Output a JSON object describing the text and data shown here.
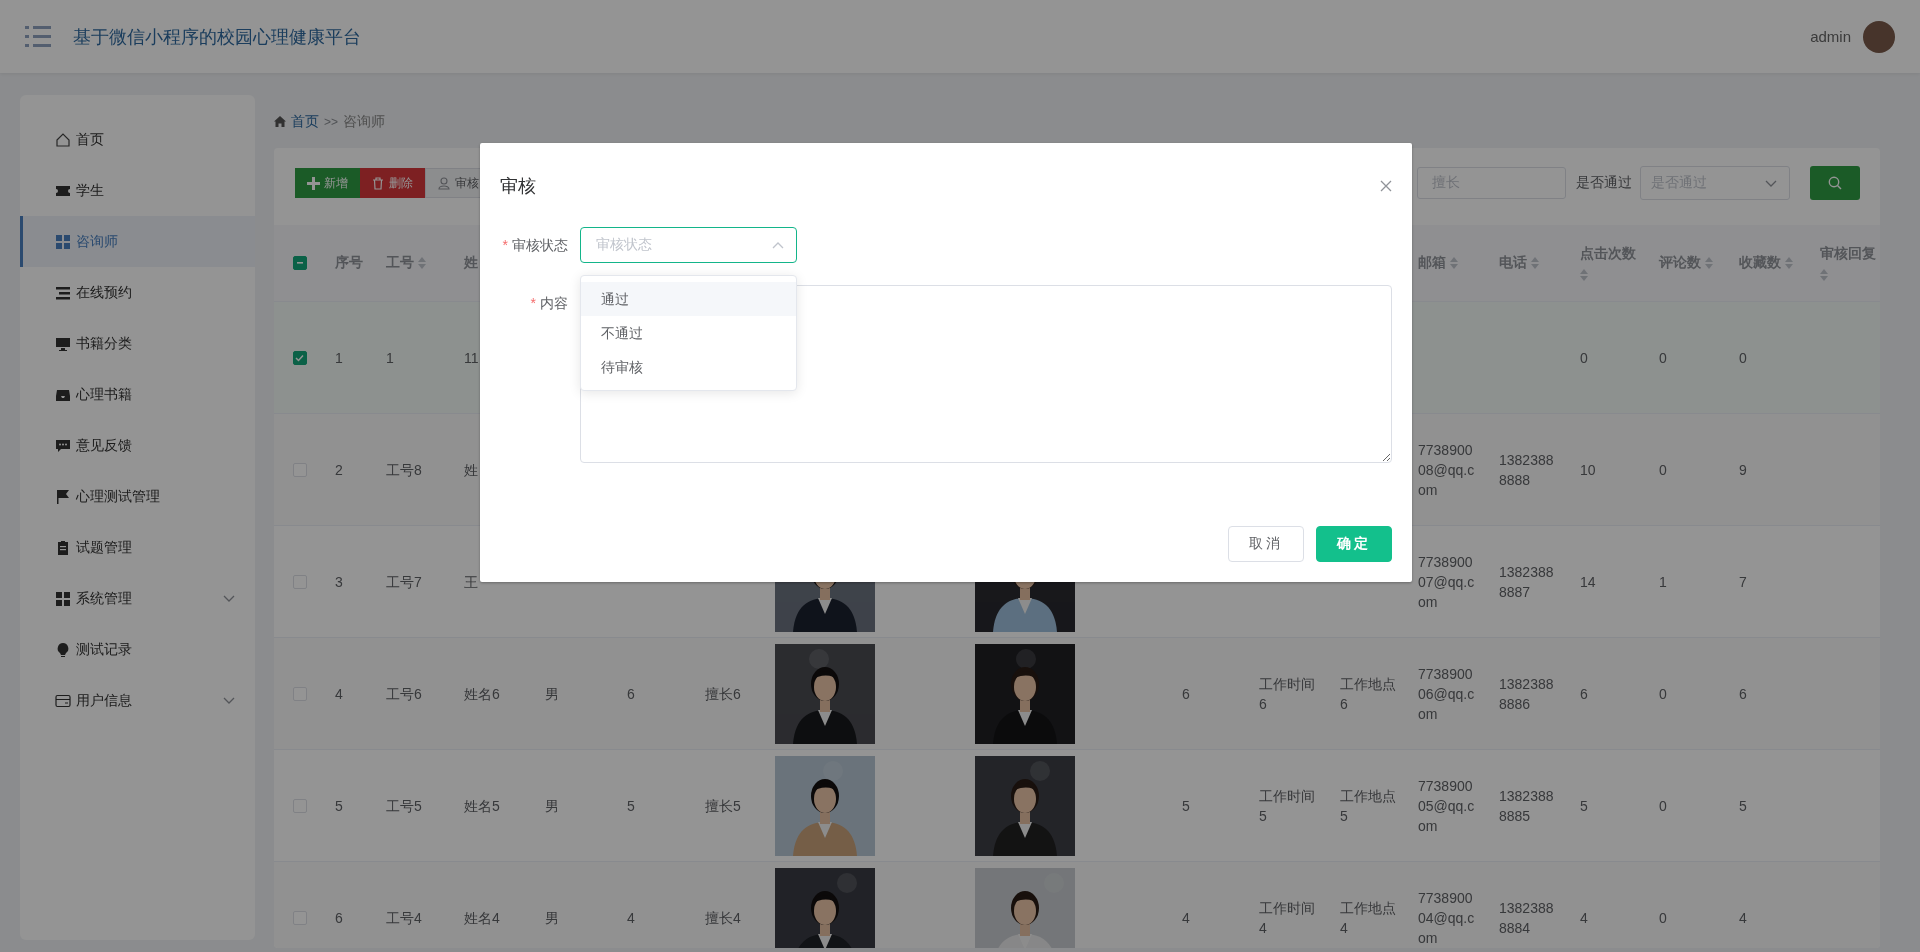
{
  "header": {
    "title": "基于微信小程序的校园心理健康平台",
    "user": "admin"
  },
  "sidebar": {
    "items": [
      {
        "label": "首页",
        "selected": false,
        "expandable": false
      },
      {
        "label": "学生",
        "selected": false,
        "expandable": false
      },
      {
        "label": "咨询师",
        "selected": true,
        "expandable": false
      },
      {
        "label": "在线预约",
        "selected": false,
        "expandable": false
      },
      {
        "label": "书籍分类",
        "selected": false,
        "expandable": false
      },
      {
        "label": "心理书籍",
        "selected": false,
        "expandable": false
      },
      {
        "label": "意见反馈",
        "selected": false,
        "expandable": false
      },
      {
        "label": "心理测试管理",
        "selected": false,
        "expandable": false
      },
      {
        "label": "试题管理",
        "selected": false,
        "expandable": false
      },
      {
        "label": "系统管理",
        "selected": false,
        "expandable": true
      },
      {
        "label": "测试记录",
        "selected": false,
        "expandable": false
      },
      {
        "label": "用户信息",
        "selected": false,
        "expandable": true
      }
    ]
  },
  "breadcrumb": {
    "items": [
      "首页",
      "咨询师"
    ],
    "separator": ">>"
  },
  "toolbar": {
    "buttons": [
      {
        "label": "新增",
        "kind": "add"
      },
      {
        "label": "删除",
        "kind": "delete"
      },
      {
        "label": "审核",
        "kind": "audit"
      }
    ],
    "filters": [
      {
        "kind": "input",
        "placeholder": "擅长"
      },
      {
        "kind": "select",
        "label": "是否通过",
        "placeholder": "是否通过"
      }
    ]
  },
  "table": {
    "select_all": {
      "indeterminate": true
    },
    "columns": [
      {
        "label": "序号",
        "sortable": false
      },
      {
        "label": "工号",
        "sortable": true
      },
      {
        "label": "姓",
        "sortable": false
      },
      null,
      null,
      null,
      null,
      null,
      null,
      null,
      null,
      {
        "label": "邮箱",
        "sortable": true
      },
      {
        "label": "电话",
        "sortable": true
      },
      {
        "label": "点击次数",
        "sortable": true
      },
      {
        "label": "评论数",
        "sortable": true
      },
      {
        "label": "收藏数",
        "sortable": true
      },
      {
        "label": "审核回复",
        "sortable": true
      }
    ],
    "rows": [
      {
        "selected": true,
        "cells": [
          "1",
          "1",
          "11",
          null,
          null,
          null,
          null,
          null,
          null,
          null,
          null,
          null,
          null,
          "0",
          "0",
          "0",
          null
        ]
      },
      {
        "selected": false,
        "cells": [
          "2",
          "工号8",
          "姓",
          null,
          null,
          null,
          null,
          null,
          null,
          null,
          null,
          "773890008@qq.com",
          "13823888888",
          "10",
          "0",
          "9",
          null
        ]
      },
      {
        "selected": false,
        "cells": [
          "3",
          "工号7",
          "王",
          null,
          null,
          null,
          {
            "kind": "picture"
          },
          {
            "kind": "picture"
          },
          null,
          null,
          null,
          "773890007@qq.com",
          "13823888887",
          "14",
          "1",
          "7",
          null
        ]
      },
      {
        "selected": false,
        "cells": [
          "4",
          "工号6",
          "姓名6",
          "男",
          "6",
          "擅长6",
          {
            "kind": "picture"
          },
          {
            "kind": "picture"
          },
          "6",
          "工作时间6",
          "工作地点6",
          "773890006@qq.com",
          "13823888886",
          "6",
          "0",
          "6",
          null
        ]
      },
      {
        "selected": false,
        "cells": [
          "5",
          "工号5",
          "姓名5",
          "男",
          "5",
          "擅长5",
          {
            "kind": "picture"
          },
          {
            "kind": "picture"
          },
          "5",
          "工作时间5",
          "工作地点5",
          "773890005@qq.com",
          "13823888885",
          "5",
          "0",
          "5",
          null
        ]
      },
      {
        "selected": false,
        "cells": [
          "6",
          "工号4",
          "姓名4",
          "男",
          "4",
          "擅长4",
          {
            "kind": "picture"
          },
          {
            "kind": "picture"
          },
          "4",
          "工作时间4",
          "工作地点4",
          "773890004@qq.com",
          "13823888884",
          "4",
          "0",
          "4",
          null
        ]
      }
    ]
  },
  "dialog": {
    "title": "审核",
    "fields": [
      {
        "kind": "select",
        "label": "审核状态",
        "required_mark": "*",
        "placeholder": "审核状态",
        "expanded": true,
        "options": [
          {
            "label": "通过",
            "highlighted": true
          },
          {
            "label": "不通过",
            "highlighted": false
          },
          {
            "label": "待审核",
            "highlighted": false
          }
        ]
      },
      {
        "kind": "textarea",
        "label": "内容",
        "required_mark": "*"
      }
    ],
    "buttons": [
      {
        "label": "取消",
        "kind": "default"
      },
      {
        "label": "确定",
        "kind": "primary"
      }
    ]
  }
}
